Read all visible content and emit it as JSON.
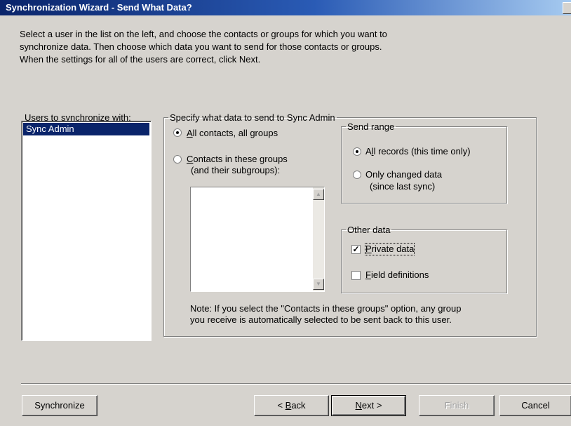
{
  "window": {
    "title": "Synchronization Wizard - Send What Data?"
  },
  "intro_text": "Select a user in the list on the left, and choose the contacts or groups for which you want to\nsynchronize data. Then choose which data you want to send for those contacts or groups.\nWhen the settings for all of the users are correct, click Next.",
  "users": {
    "label_pre": "Users to sync",
    "label_key": "h",
    "label_post": "ronize with:",
    "items": [
      "Sync Admin"
    ],
    "selected": "Sync Admin"
  },
  "specify": {
    "legend": "Specify what data to send to Sync Admin",
    "option_all_key": "A",
    "option_all_rest": "ll contacts, all groups",
    "option_groups_key": "C",
    "option_groups_rest": "ontacts in these groups",
    "option_groups_sub": "(and their subgroups):",
    "selected_option": "All contacts, all groups"
  },
  "send_range": {
    "legend": "Send range",
    "option_all_pre": "A",
    "option_all_key": "l",
    "option_all_post": "l records (this time only)",
    "option_changed_pre": "Only chan",
    "option_changed_key": "g",
    "option_changed_post": "ed data",
    "option_changed_sub": "(since last sync)",
    "selected_option": "All records (this time only)"
  },
  "other_data": {
    "legend": "Other data",
    "private_key": "P",
    "private_rest": "rivate data",
    "private_checked": true,
    "fields_key": "F",
    "fields_rest": "ield definitions",
    "fields_checked": false,
    "check_glyph": "✓"
  },
  "note_text": "Note: If you select the \"Contacts in these groups\" option, any group\nyou receive is automatically selected to be sent back to this user.",
  "buttons": {
    "synchronize": "Synchronize",
    "back_pre": "< ",
    "back_key": "B",
    "back_post": "ack",
    "next_key": "N",
    "next_post": "ext >",
    "finish": "Finish",
    "cancel": "Cancel"
  },
  "icons": {
    "scroll_up": "▲",
    "scroll_down": "▼"
  },
  "colors": {
    "title_bar": "#0a246a",
    "face": "#d6d3ce",
    "selection": "#0a246a"
  }
}
